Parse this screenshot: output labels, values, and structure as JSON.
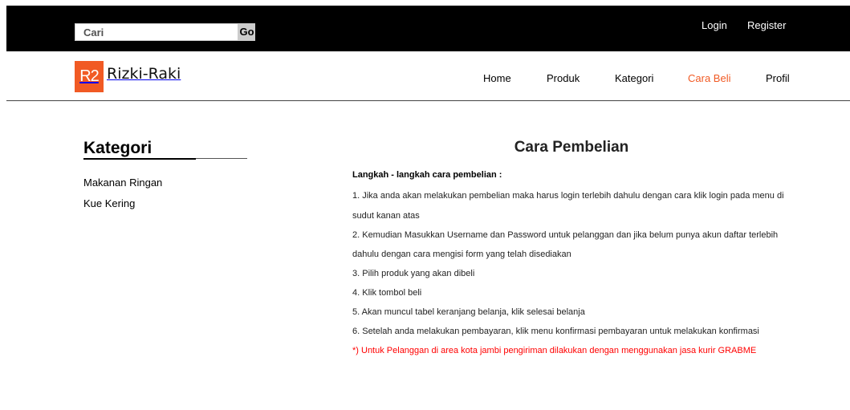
{
  "topbar": {
    "search_placeholder": "Cari",
    "go_label": "Go",
    "login_label": "Login",
    "register_label": "Register"
  },
  "brand": {
    "badge": "R2",
    "name": "Rizki-Raki",
    "color": "#f15a24"
  },
  "nav": {
    "items": [
      "Home",
      "Produk",
      "Kategori",
      "Cara Beli",
      "Profil"
    ],
    "active": "Cara Beli"
  },
  "sidebar": {
    "title": "Kategori",
    "items": [
      "Makanan Ringan",
      "Kue Kering"
    ]
  },
  "main": {
    "title": "Cara Pembelian",
    "steps_heading": "Langkah - langkah cara pembelian :",
    "lines": [
      "1. Jika anda akan melakukan pembelian maka harus login terlebih dahulu dengan cara klik login pada menu di",
      "sudut kanan atas",
      "2. Kemudian Masukkan Username dan Password untuk pelanggan dan jika belum punya akun daftar terlebih",
      "dahulu dengan cara mengisi form yang telah disediakan",
      "3. Pilih produk yang akan dibeli",
      "4. Klik tombol beli",
      "5. Akan muncul tabel keranjang belanja, klik selesai belanja",
      "6. Setelah anda melakukan pembayaran, klik menu konfirmasi pembayaran untuk melakukan konfirmasi"
    ],
    "note": "*) Untuk Pelanggan di area kota jambi pengiriman dilakukan dengan menggunakan jasa kurir GRABME",
    "note_color": "#ff0000"
  }
}
